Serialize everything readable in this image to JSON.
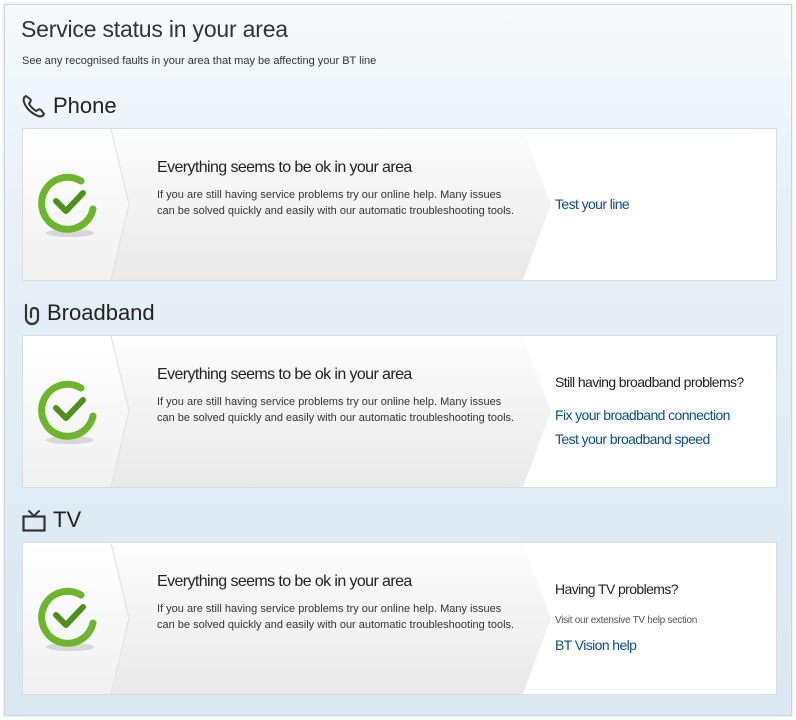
{
  "page": {
    "title": "Service status in your area",
    "subtitle": "See any recognised faults in your area that may be affecting your BT line"
  },
  "sections": {
    "phone": {
      "label": "Phone",
      "icon": "phone-handset-icon",
      "status_title": "Everything seems to be ok in your area",
      "status_body": "If you are still having service problems try our online help. Many issues can be solved quickly and easily with our automatic troubleshooting tools.",
      "link1": "Test your line"
    },
    "broadband": {
      "label": "Broadband",
      "icon": "broadband-icon",
      "status_title": "Everything seems to be ok in your area",
      "status_body": "If you are still having service problems try our online help. Many issues can be solved quickly and easily with our automatic troubleshooting tools.",
      "heading": "Still having broadband problems?",
      "link1": "Fix your broadband connection",
      "link2": "Test your broadband speed"
    },
    "tv": {
      "label": "TV",
      "icon": "tv-icon",
      "status_title": "Everything seems to be ok in your area",
      "status_body": "If you are still having service problems try our online help. Many issues can be solved quickly and easily with our automatic troubleshooting tools.",
      "heading": "Having TV problems?",
      "note": "Visit our extensive TV help section",
      "link1": "BT Vision help"
    }
  },
  "colors": {
    "link": "#0b4f8a",
    "check_green": "#6db52c"
  }
}
